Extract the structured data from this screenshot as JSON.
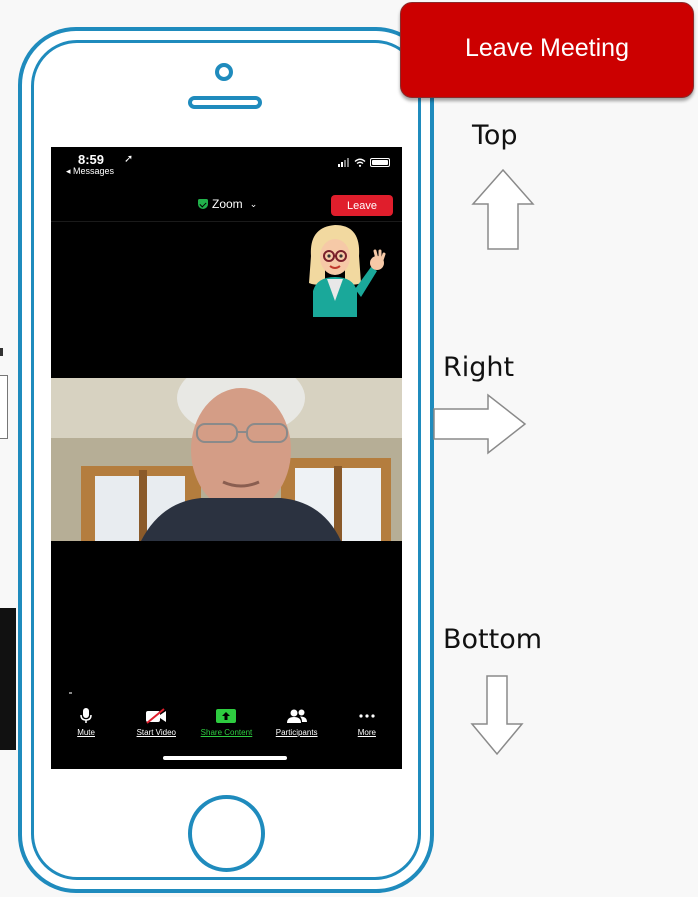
{
  "phone": {
    "status_bar": {
      "time": "8:59",
      "location_arrow": "➚",
      "back_link": "◂ Messages"
    },
    "zoom_header": {
      "title": "Zoom",
      "shield_icon": "shield-check-icon",
      "leave_button": "Leave"
    },
    "toolbar": [
      {
        "name": "mute",
        "label": "Mute",
        "icon": "microphone-icon",
        "color": "#ffffff"
      },
      {
        "name": "start-video",
        "label": "Start Video",
        "icon": "video-off-icon",
        "color": "#ffffff"
      },
      {
        "name": "share-content",
        "label": "Share Content",
        "icon": "share-arrow-icon",
        "color": "#2ecc40"
      },
      {
        "name": "participants",
        "label": "Participants",
        "icon": "people-icon",
        "color": "#ffffff"
      },
      {
        "name": "more",
        "label": "More",
        "icon": "ellipsis-icon",
        "color": "#ffffff"
      }
    ]
  },
  "leave_meeting_button": "Leave Meeting",
  "directions": {
    "top": "Top",
    "right": "Right",
    "bottom": "Bottom"
  },
  "colors": {
    "phone_outline": "#1f8bbd",
    "leave_red": "#cc0000",
    "zoom_leave": "#e01e2c",
    "share_green": "#2ecc40"
  }
}
